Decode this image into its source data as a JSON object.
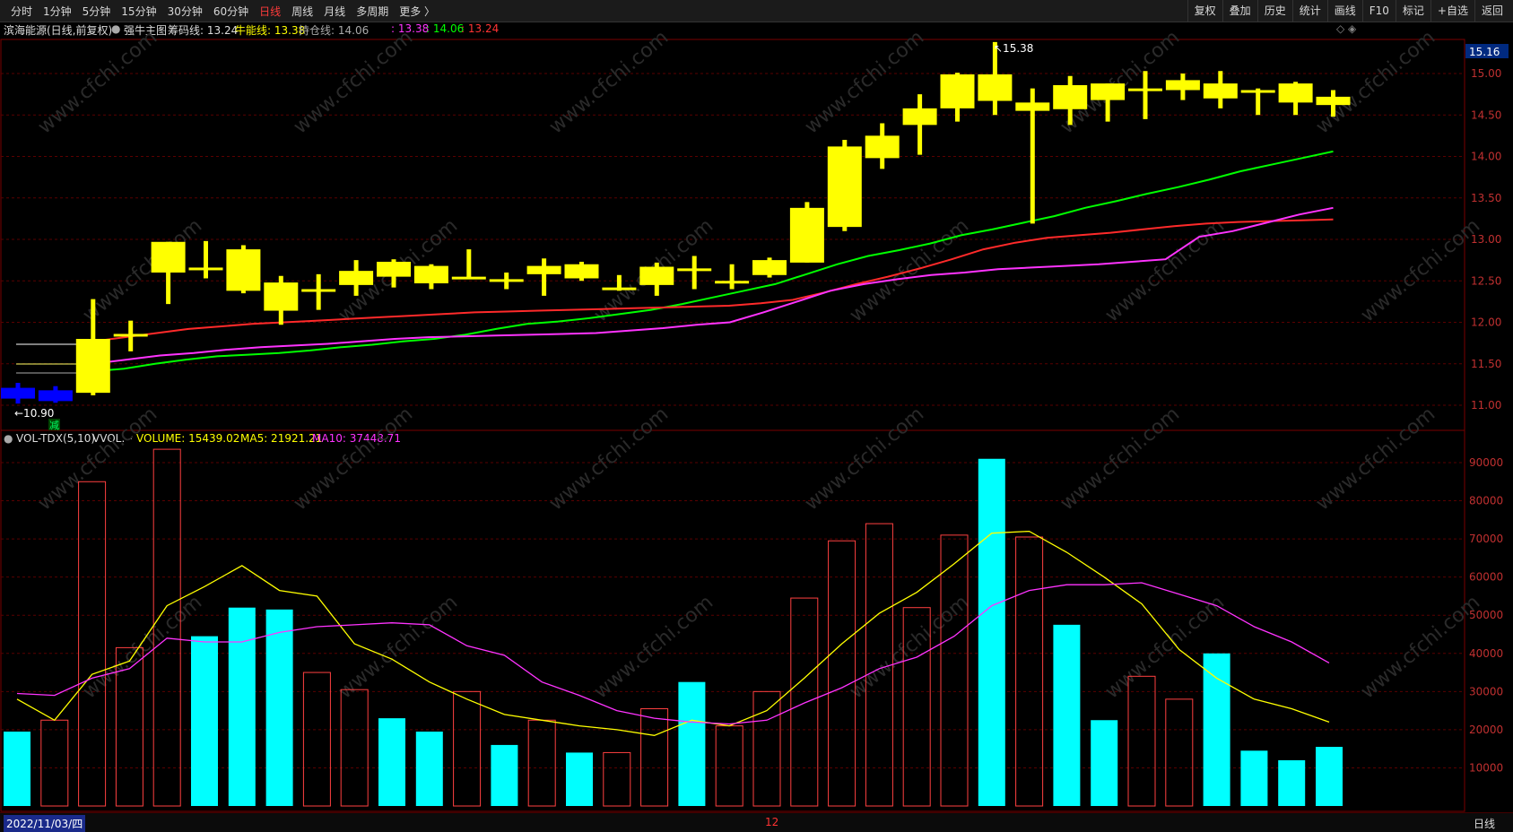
{
  "toolbar": {
    "left": [
      "分时",
      "1分钟",
      "5分钟",
      "15分钟",
      "30分钟",
      "60分钟",
      "日线",
      "周线",
      "月线",
      "多周期",
      "更多 〉"
    ],
    "active_index": 6,
    "right": [
      "复权",
      "叠加",
      "历史",
      "统计",
      "画线",
      "F10",
      "标记",
      "+自选",
      "返回"
    ]
  },
  "info": {
    "stock": "滨海能源(日线,前复权)",
    "indicator": "强牛主图",
    "chip_label": "筹码线: 13.24",
    "bull_label": "牛能线: 13.38",
    "hold_label": "持仓线: 14.06",
    "v1": ": 13.38",
    "v2": ": 14.06",
    "v3": ": 13.24",
    "corner_icons": "◇ ◈"
  },
  "price_axis": {
    "labels": [
      "15.00",
      "14.50",
      "14.00",
      "13.50",
      "13.00",
      "12.50",
      "12.00",
      "11.50",
      "11.00"
    ],
    "current": "15.16",
    "high_marker": "15.38",
    "low_marker": "←10.90",
    "low_tag": "减"
  },
  "vol": {
    "title": "VOL-TDX(5,10)",
    "vvol": "VVOL: -",
    "volume": "VOLUME: 15439.02",
    "ma5": "MA5: 21921.21",
    "ma10": "MA10: 37448.71",
    "axis": [
      "90000",
      "80000",
      "70000",
      "60000",
      "50000",
      "40000",
      "30000",
      "20000",
      "10000"
    ]
  },
  "bottom": {
    "date": "2022/11/03/四",
    "month_marker": "12",
    "period": "日线"
  },
  "colors": {
    "bull": "#ffff00",
    "red": "#ff2a2a",
    "green": "#00ff00",
    "magenta": "#ff33ff",
    "cyan": "#00ffff",
    "blue": "#0000ff"
  },
  "candles": [
    {
      "o": 11.08,
      "c": 11.21,
      "h": 11.27,
      "l": 11.02,
      "col": "blue"
    },
    {
      "o": 11.05,
      "c": 11.18,
      "h": 11.23,
      "l": 11.03,
      "col": "blue"
    },
    {
      "o": 11.15,
      "c": 11.8,
      "h": 12.28,
      "l": 11.12,
      "col": "y"
    },
    {
      "o": 11.86,
      "c": 11.86,
      "h": 12.02,
      "l": 11.65,
      "col": "y"
    },
    {
      "o": 12.6,
      "c": 12.97,
      "h": 12.97,
      "l": 12.22,
      "col": "y"
    },
    {
      "o": 12.66,
      "c": 12.66,
      "h": 12.98,
      "l": 12.53,
      "col": "y"
    },
    {
      "o": 12.88,
      "c": 12.38,
      "h": 12.93,
      "l": 12.35,
      "col": "y"
    },
    {
      "o": 12.48,
      "c": 12.14,
      "h": 12.56,
      "l": 11.97,
      "col": "y"
    },
    {
      "o": 12.4,
      "c": 12.4,
      "h": 12.58,
      "l": 12.15,
      "col": "y"
    },
    {
      "o": 12.45,
      "c": 12.62,
      "h": 12.75,
      "l": 12.32,
      "col": "y"
    },
    {
      "o": 12.55,
      "c": 12.73,
      "h": 12.76,
      "l": 12.42,
      "col": "y"
    },
    {
      "o": 12.68,
      "c": 12.47,
      "h": 12.7,
      "l": 12.4,
      "col": "y"
    },
    {
      "o": 12.55,
      "c": 12.55,
      "h": 12.88,
      "l": 12.53,
      "col": "y"
    },
    {
      "o": 12.52,
      "c": 12.52,
      "h": 12.6,
      "l": 12.4,
      "col": "y"
    },
    {
      "o": 12.58,
      "c": 12.68,
      "h": 12.77,
      "l": 12.32,
      "col": "y"
    },
    {
      "o": 12.53,
      "c": 12.7,
      "h": 12.73,
      "l": 12.5,
      "col": "y"
    },
    {
      "o": 12.42,
      "c": 12.42,
      "h": 12.57,
      "l": 12.38,
      "col": "y"
    },
    {
      "o": 12.45,
      "c": 12.67,
      "h": 12.72,
      "l": 12.32,
      "col": "y"
    },
    {
      "o": 12.65,
      "c": 12.65,
      "h": 12.8,
      "l": 12.4,
      "col": "y"
    },
    {
      "o": 12.5,
      "c": 12.5,
      "h": 12.7,
      "l": 12.4,
      "col": "y"
    },
    {
      "o": 12.57,
      "c": 12.75,
      "h": 12.78,
      "l": 12.54,
      "col": "y"
    },
    {
      "o": 12.72,
      "c": 13.38,
      "h": 13.45,
      "l": 12.72,
      "col": "y"
    },
    {
      "o": 13.15,
      "c": 14.12,
      "h": 14.2,
      "l": 13.1,
      "col": "y"
    },
    {
      "o": 13.98,
      "c": 14.25,
      "h": 14.4,
      "l": 13.85,
      "col": "y"
    },
    {
      "o": 14.38,
      "c": 14.58,
      "h": 14.75,
      "l": 14.02,
      "col": "y"
    },
    {
      "o": 14.58,
      "c": 14.99,
      "h": 15.01,
      "l": 14.42,
      "col": "y"
    },
    {
      "o": 14.99,
      "c": 14.67,
      "h": 15.38,
      "l": 14.5,
      "col": "y"
    },
    {
      "o": 14.55,
      "c": 14.65,
      "h": 14.82,
      "l": 13.19,
      "col": "y"
    },
    {
      "o": 14.57,
      "c": 14.86,
      "h": 14.97,
      "l": 14.38,
      "col": "y"
    },
    {
      "o": 14.68,
      "c": 14.88,
      "h": 14.88,
      "l": 14.42,
      "col": "y"
    },
    {
      "o": 14.82,
      "c": 14.82,
      "h": 15.03,
      "l": 14.45,
      "col": "y"
    },
    {
      "o": 14.8,
      "c": 14.92,
      "h": 15.0,
      "l": 14.68,
      "col": "y"
    },
    {
      "o": 14.7,
      "c": 14.88,
      "h": 15.03,
      "l": 14.58,
      "col": "y"
    },
    {
      "o": 14.8,
      "c": 14.8,
      "h": 14.82,
      "l": 14.5,
      "col": "y"
    },
    {
      "o": 14.65,
      "c": 14.88,
      "h": 14.9,
      "l": 14.5,
      "col": "y"
    },
    {
      "o": 14.62,
      "c": 14.72,
      "h": 14.8,
      "l": 14.48,
      "col": "y"
    }
  ],
  "volumes": [
    {
      "v": 19500,
      "t": "cyan"
    },
    {
      "v": 22500,
      "t": "red"
    },
    {
      "v": 85000,
      "t": "red"
    },
    {
      "v": 41500,
      "t": "red"
    },
    {
      "v": 93500,
      "t": "red"
    },
    {
      "v": 44500,
      "t": "cyan"
    },
    {
      "v": 52000,
      "t": "cyan"
    },
    {
      "v": 51500,
      "t": "cyan"
    },
    {
      "v": 35000,
      "t": "red"
    },
    {
      "v": 30500,
      "t": "red"
    },
    {
      "v": 23000,
      "t": "cyan"
    },
    {
      "v": 19500,
      "t": "cyan"
    },
    {
      "v": 30000,
      "t": "red"
    },
    {
      "v": 16000,
      "t": "cyan"
    },
    {
      "v": 22500,
      "t": "red"
    },
    {
      "v": 14000,
      "t": "cyan"
    },
    {
      "v": 14000,
      "t": "red"
    },
    {
      "v": 25500,
      "t": "red"
    },
    {
      "v": 32500,
      "t": "cyan"
    },
    {
      "v": 21000,
      "t": "red"
    },
    {
      "v": 30000,
      "t": "red"
    },
    {
      "v": 54500,
      "t": "red"
    },
    {
      "v": 69500,
      "t": "red"
    },
    {
      "v": 74000,
      "t": "red"
    },
    {
      "v": 52000,
      "t": "red"
    },
    {
      "v": 71000,
      "t": "red"
    },
    {
      "v": 91000,
      "t": "cyan"
    },
    {
      "v": 70500,
      "t": "red"
    },
    {
      "v": 47500,
      "t": "cyan"
    },
    {
      "v": 22500,
      "t": "cyan"
    },
    {
      "v": 34000,
      "t": "red"
    },
    {
      "v": 28000,
      "t": "red"
    },
    {
      "v": 40000,
      "t": "cyan"
    },
    {
      "v": 14500,
      "t": "cyan"
    },
    {
      "v": 12000,
      "t": "cyan"
    },
    {
      "v": 15500,
      "t": "cyan"
    }
  ],
  "ma5": [
    28000,
    22500,
    34500,
    38000,
    52500,
    57500,
    63000,
    56500,
    55000,
    42500,
    38500,
    32500,
    28000,
    24000,
    22500,
    21000,
    20000,
    18500,
    22500,
    21000,
    25000,
    33500,
    42500,
    50500,
    56000,
    63500,
    71500,
    72000,
    66500,
    60000,
    53000,
    41000,
    33500,
    28000,
    25500,
    22000
  ],
  "ma10": [
    29500,
    29000,
    33500,
    36000,
    44000,
    43000,
    43000,
    45500,
    47000,
    47500,
    48000,
    47500,
    42000,
    39500,
    32500,
    29000,
    25000,
    23000,
    22000,
    21500,
    22500,
    27000,
    31000,
    36000,
    39000,
    44500,
    52500,
    56500,
    58000,
    58000,
    58500,
    55500,
    52500,
    47000,
    43000,
    37500
  ],
  "line_green": [
    11.41,
    11.44,
    11.5,
    11.55,
    11.59,
    11.61,
    11.63,
    11.66,
    11.7,
    11.73,
    11.77,
    11.8,
    11.85,
    11.92,
    11.98,
    12.01,
    12.05,
    12.1,
    12.15,
    12.22,
    12.3,
    12.38,
    12.46,
    12.58,
    12.7,
    12.8,
    12.87,
    12.95,
    13.05,
    13.12,
    13.2,
    13.28,
    13.38,
    13.46,
    13.55,
    13.63,
    13.72,
    13.82,
    13.9,
    13.98,
    14.06
  ],
  "line_red": [
    11.77,
    11.82,
    11.87,
    11.92,
    11.95,
    11.98,
    12.0,
    12.02,
    12.04,
    12.06,
    12.08,
    12.1,
    12.12,
    12.13,
    12.14,
    12.15,
    12.16,
    12.17,
    12.18,
    12.19,
    12.2,
    12.23,
    12.27,
    12.36,
    12.46,
    12.55,
    12.65,
    12.76,
    12.88,
    12.96,
    13.02,
    13.05,
    13.08,
    13.12,
    13.16,
    13.19,
    13.21,
    13.22,
    13.23,
    13.24
  ],
  "line_magenta": [
    11.5,
    11.55,
    11.6,
    11.63,
    11.67,
    11.7,
    11.72,
    11.74,
    11.77,
    11.8,
    11.82,
    11.83,
    11.84,
    11.85,
    11.86,
    11.87,
    11.9,
    11.93,
    11.97,
    12.0,
    12.12,
    12.25,
    12.38,
    12.46,
    12.52,
    12.57,
    12.6,
    12.64,
    12.66,
    12.68,
    12.7,
    12.73,
    12.76,
    13.03,
    13.1,
    13.2,
    13.3,
    13.38
  ]
}
